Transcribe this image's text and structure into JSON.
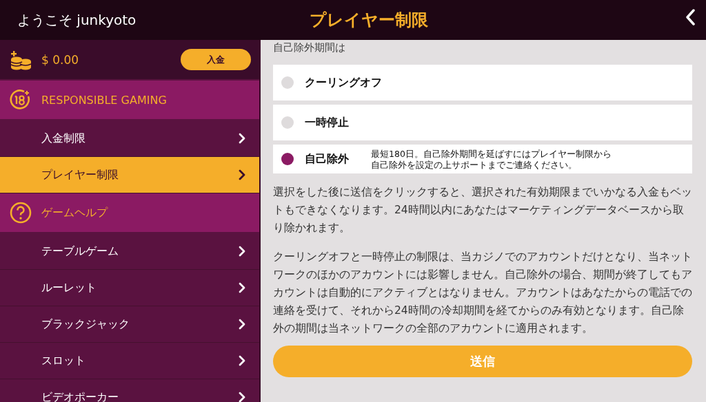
{
  "header": {
    "welcome": "ようこそ junkyoto",
    "title": "プレイヤー制限"
  },
  "balance": {
    "amount": "$ 0.00",
    "deposit_button": "入金"
  },
  "menu": [
    {
      "kind": "section",
      "label": "RESPONSIBLE GAMING"
    },
    {
      "kind": "item",
      "label": "入金制限",
      "selected": false
    },
    {
      "kind": "item",
      "label": "プレイヤー制限",
      "selected": true
    },
    {
      "kind": "section",
      "label": "ゲームヘルプ"
    },
    {
      "kind": "item",
      "label": "テーブルゲーム",
      "selected": false
    },
    {
      "kind": "item",
      "label": "ルーレット",
      "selected": false
    },
    {
      "kind": "item",
      "label": "ブラックジャック",
      "selected": false
    },
    {
      "kind": "item",
      "label": "スロット",
      "selected": false
    },
    {
      "kind": "item",
      "label": "ビデオポーカー",
      "selected": false
    }
  ],
  "heading": "自己除外期間は",
  "options": [
    {
      "label": "クーリングオフ",
      "selected": false
    },
    {
      "label": "一時停止",
      "selected": false
    },
    {
      "label": "自己除外",
      "selected": true,
      "description": "最短180日。自己除外期間を延ばすにはプレイヤー制限から自己除外を設定の上サポートまでご連絡ください。"
    }
  ],
  "paragraphs": [
    "選択をした後に送信をクリックすると、選択された有効期限までいかなる入金もベットもできなくなります。24時間以内にあなたはマーケティングデータベースから取り除かれます。",
    "クーリングオフと一時停止の制限は、当カジノでのアカウントだけとなり、当ネットワークのほかのアカウントには影響しません。自己除外の場合、期間が終了してもアカウントは自動的にアクティブとはなりません。アカウントはあなたからの電話での連絡を受けて、それから24時間の冷却期間を経てからのみ有効となります。自己除外の期間は当ネットワークの全部のアカウントに適用されます。"
  ],
  "submit_button": "送信"
}
